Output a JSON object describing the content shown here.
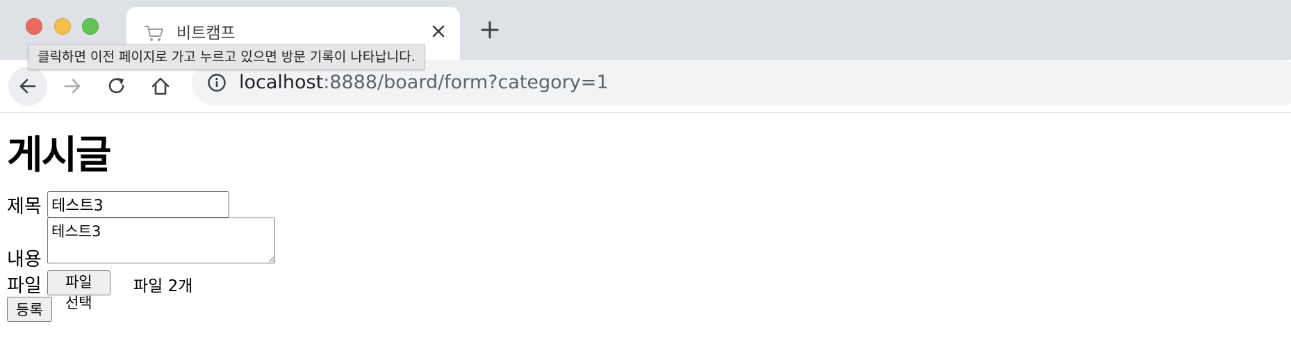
{
  "window": {
    "traffic_lights": {
      "close": "#ed6a5e",
      "minimize": "#f5bf4f",
      "zoom": "#61c554"
    }
  },
  "tab": {
    "title": "비트캠프",
    "favicon": "cart-icon"
  },
  "toolbar": {
    "url_host": "localhost",
    "url_path": ":8888/board/form?category=1"
  },
  "tooltip": {
    "text": "클릭하면 이전 페이지로 가고 누르고 있으면 방문 기록이 나타납니다."
  },
  "page": {
    "title": "게시글",
    "form": {
      "title_label": "제목",
      "title_value": "테스트3",
      "content_label": "내용",
      "content_value": "테스트3",
      "file_label": "파일",
      "file_button": "파일 선택",
      "file_status": "파일 2개",
      "submit_label": "등록"
    }
  }
}
